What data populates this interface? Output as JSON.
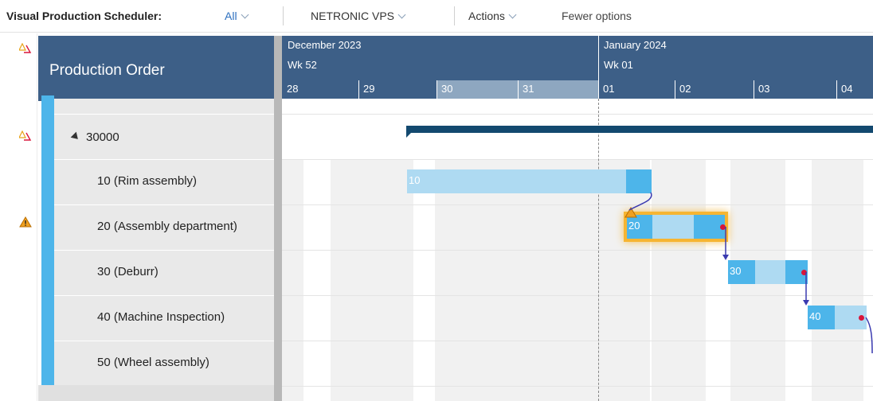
{
  "toolbar": {
    "title": "Visual Production Scheduler:",
    "filter": "All",
    "vps": "NETRONIC VPS",
    "actions": "Actions",
    "fewer": "Fewer options"
  },
  "header": {
    "left_title": "Production Order",
    "month1": "December 2023",
    "week1": "Wk 52",
    "month2": "January 2024",
    "week2": "Wk 01",
    "days": [
      "28",
      "29",
      "30",
      "31",
      "01",
      "02",
      "03",
      "04"
    ]
  },
  "rows": {
    "group": "30000",
    "ops": [
      "10 (Rim assembly)",
      "20 (Assembly department)",
      "30 (Deburr)",
      "40 (Machine Inspection)",
      "50 (Wheel assembly)"
    ]
  },
  "bars": {
    "b10": "10",
    "b20": "20",
    "b30": "30",
    "b40": "40"
  },
  "colors": {
    "header_bg": "#3d5f87",
    "summary_bar": "#13496f",
    "bar_light": "#aedaf2",
    "bar_dark": "#4db5ea",
    "selection_glow": "#f6b532",
    "dot": "#d8153a",
    "link": "#3a3ab0"
  },
  "icons": {
    "warn_red": "warning-stack-icon",
    "warn_orange": "warning-triangle-icon"
  }
}
